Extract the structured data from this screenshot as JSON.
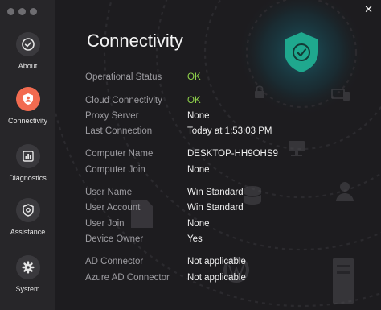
{
  "window": {
    "close_glyph": "✕"
  },
  "sidebar": {
    "items": [
      {
        "label": "About",
        "icon": "check-circle-icon"
      },
      {
        "label": "Connectivity",
        "icon": "user-shield-icon",
        "active": true
      },
      {
        "label": "Diagnostics",
        "icon": "bar-chart-icon"
      },
      {
        "label": "Assistance",
        "icon": "shield-gear-icon"
      },
      {
        "label": "System",
        "icon": "gear-icon"
      }
    ]
  },
  "main": {
    "title": "Connectivity",
    "rows": [
      {
        "label": "Operational Status",
        "value": "OK",
        "status": "ok"
      },
      {
        "label": "Cloud Connectivity",
        "value": "OK",
        "status": "ok"
      },
      {
        "label": "Proxy Server",
        "value": "None"
      },
      {
        "label": "Last Connection",
        "value": "Today at 1:53:03 PM"
      },
      {
        "label": "Computer Name",
        "value": "DESKTOP-HH9OHS9"
      },
      {
        "label": "Computer Join",
        "value": "None"
      },
      {
        "label": "User Name",
        "value": "Win Standard"
      },
      {
        "label": "User Account",
        "value": "Win Standard"
      },
      {
        "label": "User Join",
        "value": "None"
      },
      {
        "label": "Device Owner",
        "value": "Yes"
      },
      {
        "label": "AD Connector",
        "value": "Not applicable"
      },
      {
        "label": "Azure AD Connector",
        "value": "Not applicable"
      }
    ]
  },
  "colors": {
    "accent": "#f26b50",
    "ok": "#8ed14a",
    "shield": "#1fa88e",
    "sidebar_bg": "#272629",
    "main_bg": "#1d1c1f"
  }
}
